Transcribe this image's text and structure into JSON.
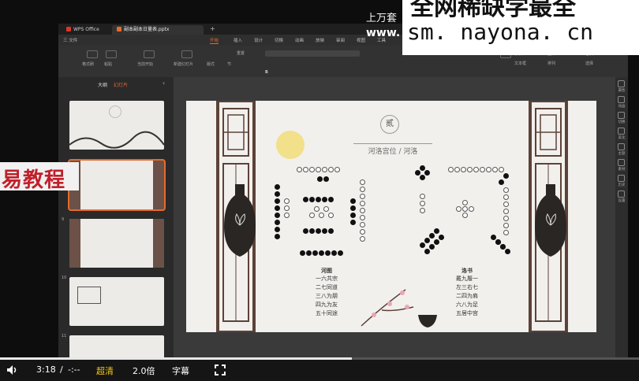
{
  "watermark": {
    "top_text": "全网稀缺学最全",
    "url": "sm. nayona. cn"
  },
  "top_overlay": {
    "line1": "上万套",
    "line2": "www."
  },
  "banner": {
    "text": "易教程"
  },
  "wps": {
    "tabs": [
      {
        "label": "WPS Office"
      },
      {
        "label": "副本副本日量表.pptx"
      }
    ],
    "menu": [
      "三 文件",
      "开始",
      "插入",
      "设计",
      "切换",
      "动画",
      "放映",
      "审阅",
      "视图",
      "工具"
    ],
    "ribbon": {
      "buttons": [
        "格式刷",
        "粘贴",
        "当前开始",
        "新建幻灯片",
        "版式",
        "节",
        "重置",
        "形状",
        "图片",
        "文本框",
        "排列",
        "替换",
        "选择"
      ]
    },
    "left_panel": {
      "tabs": [
        "大纲",
        "幻灯片"
      ],
      "thumb_numbers": [
        "",
        "",
        "9",
        "10",
        "11"
      ]
    },
    "right_bar": [
      "属性",
      "动画",
      "切换",
      "美化",
      "主题",
      "素材",
      "历史",
      "设置"
    ]
  },
  "slide": {
    "badge": "贰",
    "heading": "河洛宫位 / 河洛",
    "hetu": {
      "title": "河图",
      "lines": [
        "一六共宗",
        "二七同道",
        "三八为朋",
        "四九为友",
        "五十同途"
      ]
    },
    "luoshu": {
      "title": "洛书",
      "lines": [
        "戴九履一",
        "左三右七",
        "二四为肩",
        "六八为足",
        "五居中宫"
      ]
    }
  },
  "player": {
    "time_current": "3:18",
    "time_sep": "/",
    "time_total": "-:--",
    "quality": "超清",
    "speed": "2.0倍",
    "subtitle": "字幕",
    "progress": 0.55
  },
  "colors": {
    "accent": "#e66a2c",
    "banner_red": "#c0202a"
  }
}
